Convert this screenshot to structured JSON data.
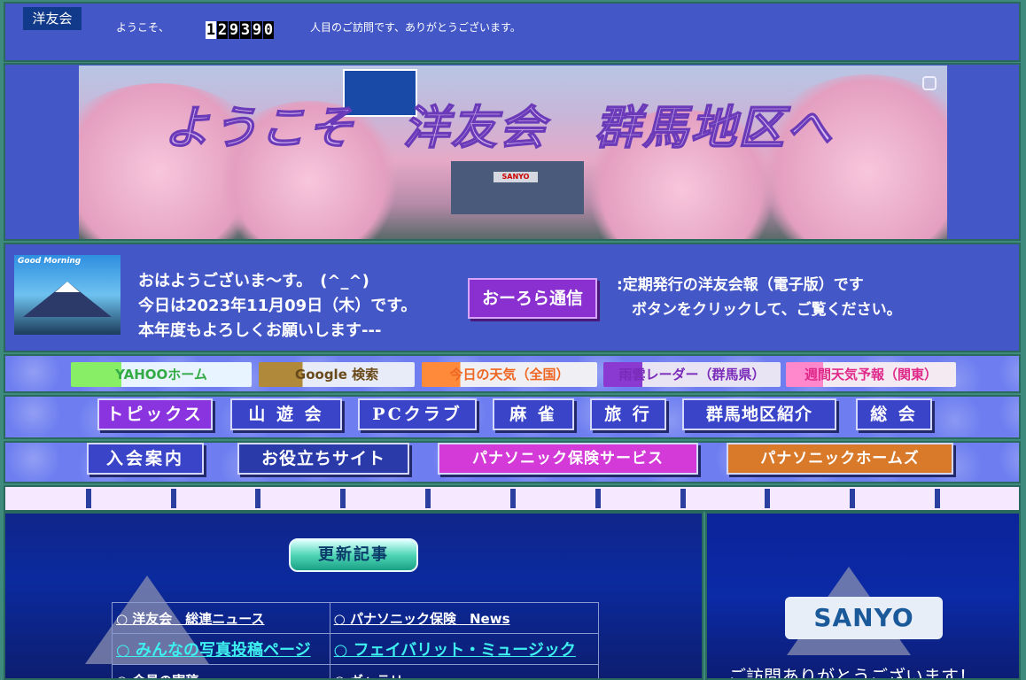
{
  "header": {
    "logo_text": "洋友会",
    "welcome": "ようこそ、",
    "counter": [
      "1",
      "2",
      "9",
      "3",
      "9",
      "0"
    ],
    "thanks": "人目のご訪問です、ありがとうございます。"
  },
  "banner": {
    "title": "ようこそ　洋友会　群馬地区へ",
    "gate_sign": "SANYO"
  },
  "greeting": {
    "image_caption": "Good Morning",
    "lines": [
      "おはようございま～す。　(^_^)",
      "今日は2023年11月09日（木）です。",
      "本年度もよろしくお願いします---"
    ],
    "aurora_button": "おーろら通信",
    "aurora_desc": [
      ":定期発行の洋友会報（電子版）です",
      "　ボタンをクリックして、ご覧ください。"
    ]
  },
  "quick_links": [
    {
      "label": "YAHOOホーム",
      "color": "#33aa44",
      "bg": "linear-gradient(90deg,#88ee66 0%,#88ee66 28%,#e8f4ff 28%)"
    },
    {
      "label": "Google 検索",
      "color": "#6a4a1a",
      "bg": "linear-gradient(90deg,#b08a3a 0%,#b08a3a 28%,#e8ecf8 28%)"
    },
    {
      "label": "今日の天気（全国）",
      "color": "#ee6622",
      "bg": "linear-gradient(90deg,#ff8a3a 0%,#ff8a3a 22%,#f0f0f4 22%)"
    },
    {
      "label": "雨雲レーダー（群馬県）",
      "color": "#7a2ab8",
      "bg": "linear-gradient(90deg,#8a3ad0 0%,#8a3ad0 22%,#e8e4f4 22%)"
    },
    {
      "label": "週間天気予報（関東）",
      "color": "#e02a8a",
      "bg": "linear-gradient(90deg,#ff88cc 0%,#ff88cc 22%,#f4eaf2 22%)"
    }
  ],
  "nav_row1": [
    {
      "label": "トピックス",
      "color": "#8a34e0"
    },
    {
      "label": "山 遊 会",
      "color": "#3a44c8"
    },
    {
      "label": "PCクラブ",
      "color": "#3a44c8"
    },
    {
      "label": "麻 雀",
      "color": "#3a44c8"
    },
    {
      "label": "旅 行",
      "color": "#3a44c8"
    },
    {
      "label": "群馬地区紹介",
      "color": "#3a44c8"
    },
    {
      "label": "総 会",
      "color": "#3a44c8"
    }
  ],
  "nav_row2": [
    {
      "label": "入会案内",
      "color": "#3a44c8"
    },
    {
      "label": "お役立ちサイト",
      "color": "#2a3aa8"
    },
    {
      "label": "パナソニック保険サービス",
      "color": "#d43ad8"
    },
    {
      "label": "パナソニックホームズ",
      "color": "#d87a2a"
    }
  ],
  "main": {
    "update_button": "更新記事",
    "links": [
      [
        "○ 洋友会　総連ニュース",
        "○ パナソニック保険　News"
      ],
      [
        "○ みんなの写真投稿ページ",
        "○ フェイバリット・ミュージック"
      ],
      [
        "○ 会員の寄稿",
        "○ ギャラリー"
      ]
    ]
  },
  "side": {
    "sanyo_logo": "SANYO",
    "visit_text": "ご訪問ありがとうございます！"
  }
}
